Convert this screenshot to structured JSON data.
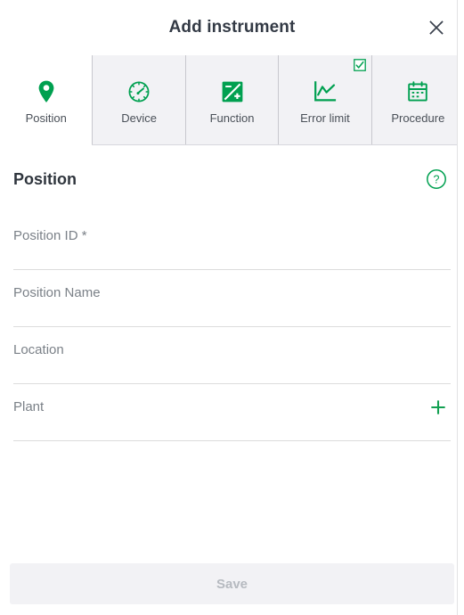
{
  "header": {
    "title": "Add instrument",
    "close_label": "Close",
    "close_icon": "close-icon"
  },
  "tabs": [
    {
      "label": "Position",
      "icon": "map-pin-icon",
      "active": true,
      "checked": false
    },
    {
      "label": "Device",
      "icon": "gauge-icon",
      "active": false,
      "checked": false
    },
    {
      "label": "Function",
      "icon": "function-icon",
      "active": false,
      "checked": false
    },
    {
      "label": "Error limit",
      "icon": "line-chart-icon",
      "active": false,
      "checked": true
    },
    {
      "label": "Procedure",
      "icon": "calendar-icon",
      "active": false,
      "checked": false
    }
  ],
  "section": {
    "title": "Position",
    "help_icon": "question-circle-icon"
  },
  "fields": [
    {
      "label": "Position ID",
      "required": true,
      "value": "",
      "placeholder": "Position ID",
      "add": false
    },
    {
      "label": "Position Name",
      "required": false,
      "value": "",
      "placeholder": "Position Name",
      "add": false
    },
    {
      "label": "Location",
      "required": false,
      "value": "",
      "placeholder": "Location",
      "add": false
    },
    {
      "label": "Plant",
      "required": false,
      "value": "",
      "placeholder": "Plant",
      "add": true,
      "add_icon": "plus-icon"
    }
  ],
  "footer": {
    "save_label": "Save",
    "save_enabled": false
  },
  "colors": {
    "accent_green": "#00a050",
    "tab_inactive_bg": "#f2f2f5",
    "tab_active_bg": "#ffffff",
    "text_dark": "#333a45",
    "text_muted": "#7b8188",
    "disabled_text": "#b6bac0",
    "divider": "#dcdcdc"
  }
}
